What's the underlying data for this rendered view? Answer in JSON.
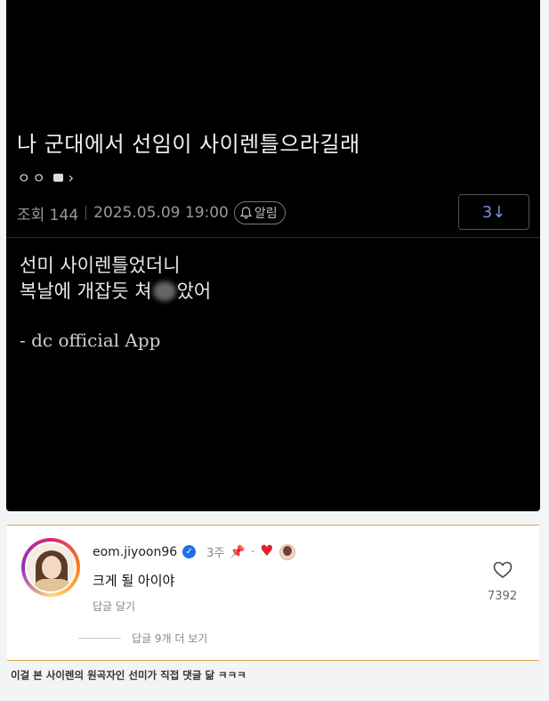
{
  "post": {
    "title": "나 군대에서 선임이 사이렌틀으라길래",
    "author_name": "ㅇㅇ",
    "views_label": "조회 144",
    "date": "2025.05.09 19:00",
    "alarm_label": "알림",
    "down_button_label": "3↓",
    "body_line1": "선미 사이렌틀었더니",
    "body_line2_a": "복날에 개잡듯 쳐",
    "body_line2_b": "았어",
    "signature": "- dc official App"
  },
  "comment": {
    "username": "eom.jiyoon96",
    "time": "3주",
    "text": "크게 될 아이야",
    "reply_label": "답글 달기",
    "like_count": "7392",
    "more_replies_label": "답글 9개 더 보기"
  },
  "caption": "이걸 본 사이렌의 원곡자인 선미가 직접 댓글 닮 ㅋㅋㅋ",
  "colors": {
    "post_bg": "#000000",
    "accent_blue": "#7a8fd8",
    "verified": "#1f6fe5",
    "heart": "#e0202c"
  }
}
